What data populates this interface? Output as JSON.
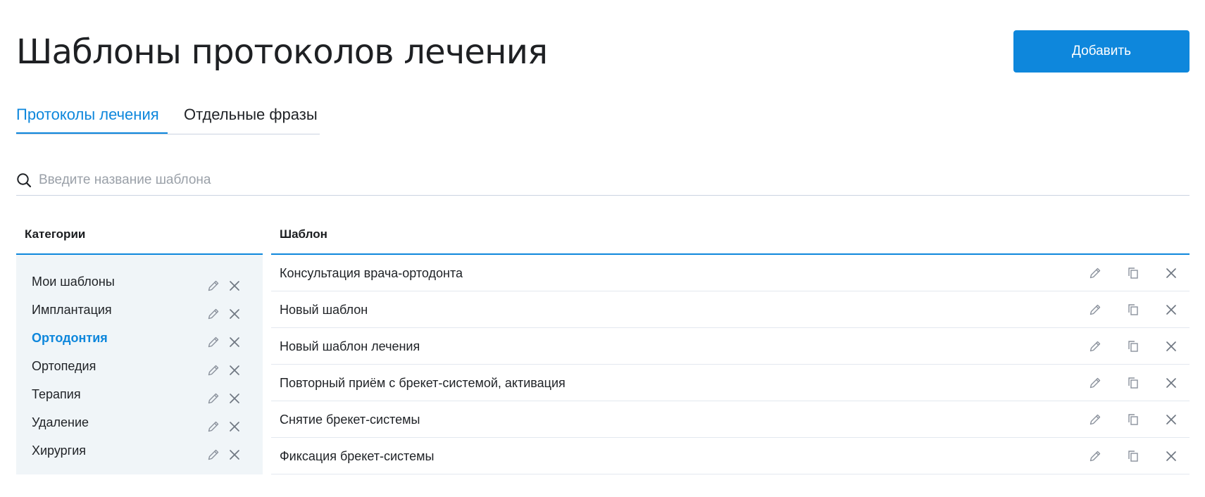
{
  "header": {
    "title": "Шаблоны протоколов лечения",
    "add_label": "Добавить"
  },
  "tabs": [
    {
      "label": "Протоколы лечения",
      "active": true
    },
    {
      "label": "Отдельные фразы",
      "active": false
    }
  ],
  "search": {
    "placeholder": "Введите название шаблона",
    "value": "",
    "icon": "search-icon"
  },
  "categories": {
    "header": "Категории",
    "items": [
      {
        "label": "Мои шаблоны",
        "selected": false
      },
      {
        "label": "Имплантация",
        "selected": false
      },
      {
        "label": "Ортодонтия",
        "selected": true
      },
      {
        "label": "Ортопедия",
        "selected": false
      },
      {
        "label": "Терапия",
        "selected": false
      },
      {
        "label": "Удаление",
        "selected": false
      },
      {
        "label": "Хирургия",
        "selected": false
      }
    ],
    "item_icons": [
      "pencil-icon",
      "close-icon"
    ]
  },
  "templates": {
    "header": "Шаблон",
    "rows": [
      {
        "label": "Консультация врача-ортодонта"
      },
      {
        "label": "Новый шаблон"
      },
      {
        "label": "Новый шаблон лечения"
      },
      {
        "label": "Повторный приём с брекет-системой, активация"
      },
      {
        "label": "Снятие брекет-системы"
      },
      {
        "label": "Фиксация брекет-системы"
      }
    ],
    "row_icons": [
      "pencil-icon",
      "copy-icon",
      "close-icon"
    ]
  },
  "colors": {
    "accent": "#0e87dc",
    "sidebar_bg": "#f0f5f8",
    "icon": "#8a919c",
    "divider": "#cbd3e1"
  }
}
